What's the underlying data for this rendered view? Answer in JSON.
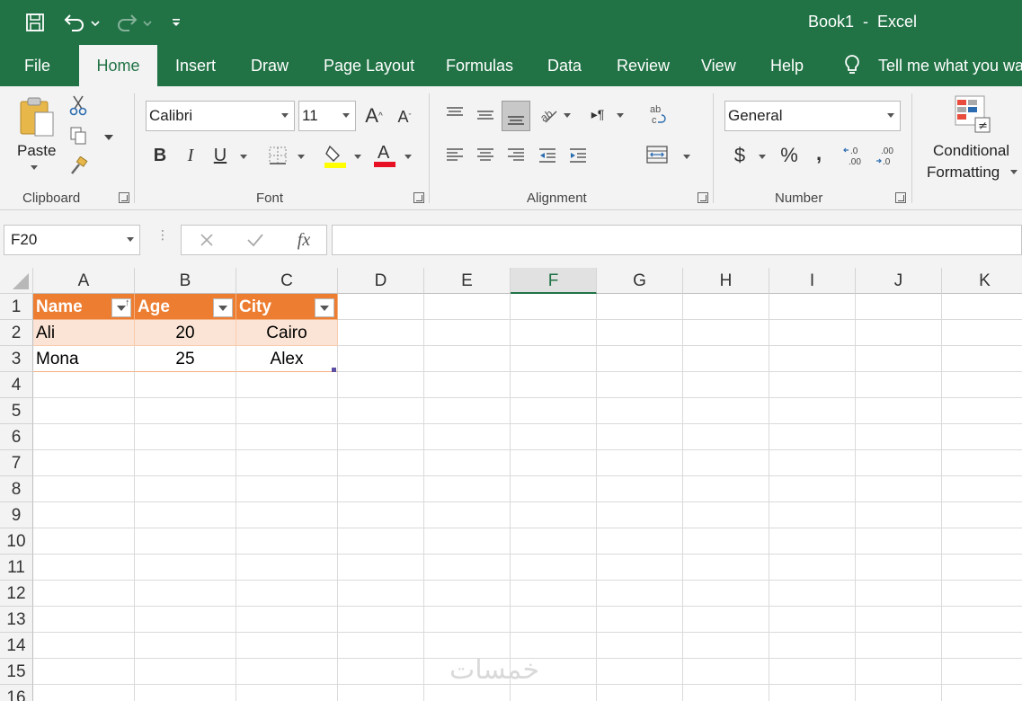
{
  "title_bar": {
    "doc_title": "Book1  -  Excel"
  },
  "tabs": [
    {
      "label": "File"
    },
    {
      "label": "Home"
    },
    {
      "label": "Insert"
    },
    {
      "label": "Draw"
    },
    {
      "label": "Page Layout"
    },
    {
      "label": "Formulas"
    },
    {
      "label": "Data"
    },
    {
      "label": "Review"
    },
    {
      "label": "View"
    },
    {
      "label": "Help"
    }
  ],
  "tell_me": "Tell me what you wa",
  "ribbon": {
    "clipboard": {
      "paste": "Paste",
      "label": "Clipboard"
    },
    "font": {
      "family": "Calibri",
      "size": "11",
      "label": "Font"
    },
    "alignment": {
      "label": "Alignment"
    },
    "number": {
      "format": "General",
      "label": "Number"
    },
    "styles": {
      "conditional_1": "Conditional",
      "conditional_2": "Formatting"
    }
  },
  "formula_bar": {
    "name_box": "F20",
    "fx": "fx",
    "value": ""
  },
  "columns": [
    "A",
    "B",
    "C",
    "D",
    "E",
    "F",
    "G",
    "H",
    "I",
    "J",
    "K"
  ],
  "selected_column": "F",
  "rows": [
    "1",
    "2",
    "3",
    "4",
    "5",
    "6",
    "7",
    "8",
    "9",
    "10",
    "11",
    "12",
    "13",
    "14",
    "15",
    "16"
  ],
  "table": {
    "headers": [
      "Name",
      "Age",
      "City"
    ],
    "data": [
      [
        "Ali",
        "20",
        "Cairo"
      ],
      [
        "Mona",
        "25",
        "Alex"
      ]
    ]
  },
  "watermark": "خمسات",
  "colors": {
    "excel_green": "#217346",
    "table_header": "#ed7d31",
    "band": "#fbe4d5"
  }
}
